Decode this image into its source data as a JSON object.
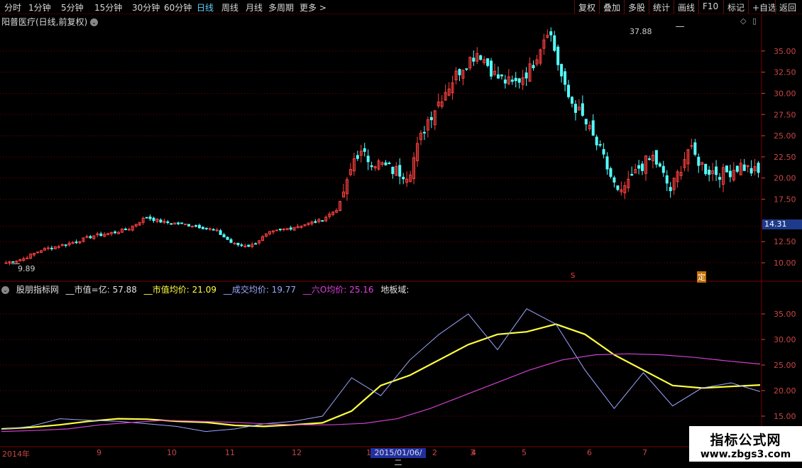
{
  "toolbar": {
    "left_items": [
      "分时",
      "1分钟",
      "5分钟",
      "15分钟",
      "30分钟",
      "60分钟",
      "日线",
      "周线",
      "月线",
      "多周期",
      "更多 >"
    ],
    "active_item": "日线",
    "right_items": [
      "复权",
      "叠加",
      "多股",
      "统计",
      "画线",
      "F10",
      "标记",
      "+自选",
      "返回"
    ]
  },
  "stock": {
    "title": "阳普医疗(日线,前复权)",
    "max_label": "37.88",
    "min_label": "9.89",
    "current_price": "14.31"
  },
  "price_axis": [
    "35.00",
    "32.50",
    "30.00",
    "27.50",
    "25.00",
    "22.50",
    "20.00",
    "17.50",
    "12.50",
    "10.00"
  ],
  "markers": {
    "s": "S",
    "ding": "定"
  },
  "indicator": {
    "name": "股朋指标网",
    "items": [
      {
        "label": "__市值=亿: 57.88",
        "color": "#e0e0e0"
      },
      {
        "label": "__市值均价: 21.09",
        "color": "#ffff40"
      },
      {
        "label": "__成交均价: 19.77",
        "color": "#9aa8ff"
      },
      {
        "label": "__六O均价: 25.16",
        "color": "#e040e0"
      },
      {
        "label": "地板域:",
        "color": "#e0e0e0"
      }
    ],
    "axis": [
      "35.00",
      "30.00",
      "25.00",
      "20.00",
      "15.00"
    ]
  },
  "x_axis": {
    "labels": [
      "2014年",
      "9",
      "10",
      "11",
      "12",
      "1",
      "2",
      "3",
      "4",
      "5",
      "6",
      "7"
    ],
    "cursor_date": "2015/01/06/二"
  },
  "watermark": {
    "line1": "指标公式网",
    "line2": "www.zbgs3.com"
  },
  "colors": {
    "up": "#ff4040",
    "down": "#54ffff",
    "grid": "#7a0000",
    "yellow": "#ffff40",
    "purple": "#d040d0",
    "blue": "#9aa8ff"
  },
  "chart_data": {
    "type": "candlestick",
    "title": "阳普医疗(日线,前复权)",
    "y_range_price": [
      9.0,
      39.0
    ],
    "close_samples": [
      10.0,
      10.5,
      11.5,
      12.0,
      12.5,
      13.2,
      13.5,
      14.0,
      15.4,
      14.8,
      14.6,
      14.3,
      13.8,
      12.2,
      12.0,
      13.5,
      14.0,
      14.5,
      15.0,
      16.5,
      23.0,
      22.0,
      21.0,
      20.5,
      26.5,
      30.0,
      33.0,
      35.0,
      32.0,
      31.0,
      33.0,
      37.88,
      30.0,
      27.0,
      23.0,
      18.0,
      21.0,
      22.5,
      18.5,
      23.5,
      21.0,
      20.5,
      21.5,
      20.5
    ],
    "indicator_series": [
      {
        "name": "市值均价",
        "values": [
          12.5,
          12.8,
          13.3,
          14.0,
          14.5,
          14.4,
          14.0,
          13.8,
          13.2,
          13.0,
          13.3,
          13.7,
          16.0,
          21.0,
          23.0,
          26.0,
          29.0,
          31.0,
          31.5,
          33.0,
          31.0,
          27.0,
          24.0,
          21.0,
          20.5,
          20.8,
          21.1
        ]
      },
      {
        "name": "成交均价",
        "values": [
          12.4,
          13.0,
          14.5,
          14.2,
          14.0,
          13.5,
          13.0,
          12.0,
          12.5,
          13.5,
          14.0,
          15.0,
          22.5,
          19.0,
          26.0,
          31.0,
          35.0,
          28.0,
          36.0,
          33.0,
          24.0,
          16.5,
          23.5,
          17.0,
          20.5,
          21.5,
          19.8
        ]
      },
      {
        "name": "六O均价",
        "values": [
          12.0,
          12.2,
          12.5,
          13.3,
          13.8,
          14.2,
          14.0,
          13.8,
          13.5,
          13.3,
          13.3,
          13.6,
          14.5,
          16.5,
          19.0,
          21.5,
          24.0,
          26.0,
          27.0,
          27.2,
          27.0,
          26.5,
          25.8,
          25.2
        ]
      }
    ],
    "indicator_y_range": [
      12.0,
      38.0
    ]
  }
}
